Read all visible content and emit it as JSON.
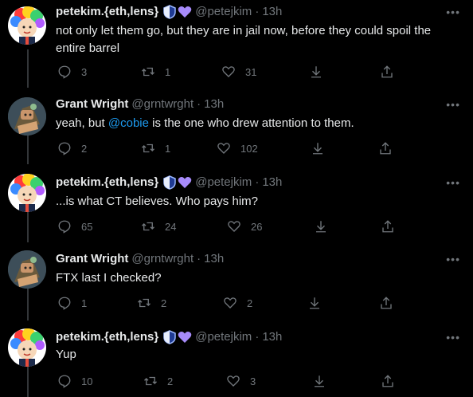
{
  "tweets": [
    {
      "name": "petekim.{eth,lens}",
      "handle": "@petejkim",
      "time": "13h",
      "badges": true,
      "text_before": "not only let them go, but they are in jail now, before they could spoil the entire barrel",
      "mention": "",
      "text_after": "",
      "replies": "3",
      "retweets": "1",
      "likes": "31"
    },
    {
      "name": "Grant Wright",
      "handle": "@grntwrght",
      "time": "13h",
      "badges": false,
      "text_before": "yeah, but ",
      "mention": "@cobie",
      "text_after": " is the one who drew attention to them.",
      "replies": "2",
      "retweets": "1",
      "likes": "102"
    },
    {
      "name": "petekim.{eth,lens}",
      "handle": "@petejkim",
      "time": "13h",
      "badges": true,
      "text_before": "...is what CT believes. Who pays him?",
      "mention": "",
      "text_after": "",
      "replies": "65",
      "retweets": "24",
      "likes": "26"
    },
    {
      "name": "Grant Wright",
      "handle": "@grntwrght",
      "time": "13h",
      "badges": false,
      "text_before": "FTX last I checked?",
      "mention": "",
      "text_after": "",
      "replies": "1",
      "retweets": "2",
      "likes": "2"
    },
    {
      "name": "petekim.{eth,lens}",
      "handle": "@petejkim",
      "time": "13h",
      "badges": true,
      "text_before": "Yup",
      "mention": "",
      "text_after": "",
      "replies": "10",
      "retweets": "2",
      "likes": "3"
    }
  ],
  "separator": "·",
  "more_label": "•••",
  "colors": {
    "background": "#000000",
    "text": "#e7e9ea",
    "muted": "#71767b",
    "link": "#1d9bf0"
  },
  "icons": [
    "reply-icon",
    "retweet-icon",
    "like-icon",
    "download-icon",
    "share-icon",
    "shield-badge-icon",
    "heart-badge-icon",
    "more-icon"
  ]
}
